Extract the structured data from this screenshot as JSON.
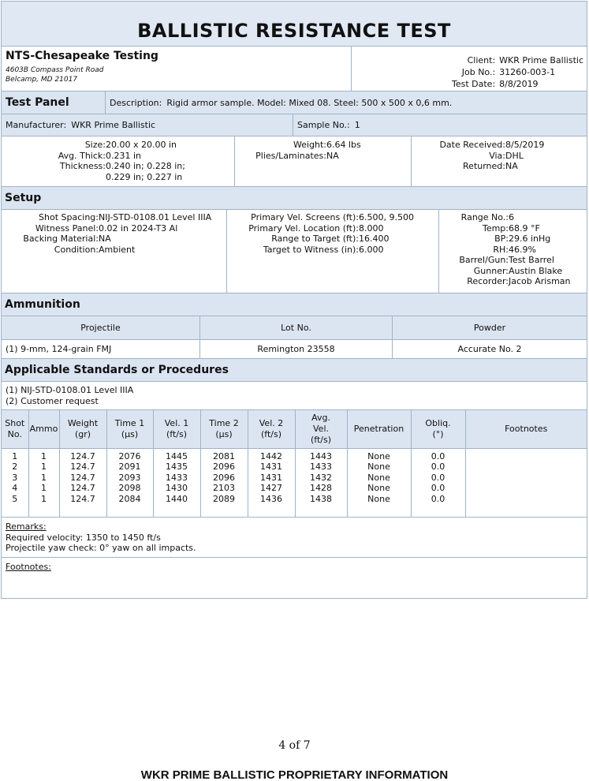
{
  "title": "BALLISTIC RESISTANCE TEST",
  "lab": {
    "name": "NTS-Chesapeake Testing",
    "address1": "4603B Compass Point Road",
    "address2": "Belcamp, MD 21017"
  },
  "client_block": {
    "client_label": "Client:",
    "client_value": "WKR Prime Ballistic",
    "job_label": "Job No.:",
    "job_value": "31260-003-1",
    "date_label": "Test Date:",
    "date_value": "8/8/2019"
  },
  "test_panel": {
    "heading": "Test Panel",
    "description_label": "Description:",
    "description_value": "Rigid armor sample. Model: Mixed 08. Steel: 500 x 500 x 0,6 mm.",
    "manufacturer_label": "Manufacturer:",
    "manufacturer_value": "WKR Prime Ballistic",
    "sample_label": "Sample No.:",
    "sample_value": "1",
    "size_label": "Size:",
    "size_value": "20.00 x 20.00 in",
    "avg_thick_label": "Avg. Thick:",
    "avg_thick_value": "0.231 in",
    "thickness_label": "Thickness:",
    "thickness_value_1": "0.240 in; 0.228 in;",
    "thickness_value_2": "0.229 in; 0.227 in",
    "weight_label": "Weight:",
    "weight_value": "6.64 lbs",
    "plies_label": "Plies/Laminates:",
    "plies_value": "NA",
    "received_label": "Date Received:",
    "received_value": "8/5/2019",
    "via_label": "Via:",
    "via_value": "DHL",
    "returned_label": "Returned:",
    "returned_value": "NA"
  },
  "setup": {
    "heading": "Setup",
    "col1": [
      {
        "label": "Shot Spacing:",
        "value": "NIJ-STD-0108.01 Level IIIA"
      },
      {
        "label": "Witness Panel:",
        "value": "0.02 in 2024-T3 Al"
      },
      {
        "label": "Backing Material:",
        "value": "NA"
      },
      {
        "label": "Condition:",
        "value": "Ambient"
      }
    ],
    "col2": [
      {
        "label": "Primary Vel. Screens (ft):",
        "value": "6.500, 9.500"
      },
      {
        "label": "Primary Vel. Location (ft):",
        "value": "8.000"
      },
      {
        "label": "Range to Target (ft):",
        "value": "16.400"
      },
      {
        "label": "Target to Witness (in):",
        "value": "6.000"
      }
    ],
    "col3": [
      {
        "label": "Range No.:",
        "value": "6"
      },
      {
        "label": "Temp:",
        "value": "68.9 °F"
      },
      {
        "label": "BP:",
        "value": "29.6 inHg"
      },
      {
        "label": "RH:",
        "value": "46.9%"
      },
      {
        "label": "Barrel/Gun:",
        "value": "Test Barrel"
      },
      {
        "label": "Gunner:",
        "value": "Austin Blake"
      },
      {
        "label": "Recorder:",
        "value": "Jacob Arisman"
      }
    ]
  },
  "ammunition": {
    "heading": "Ammunition",
    "headers": [
      "Projectile",
      "Lot No.",
      "Powder"
    ],
    "row": {
      "projectile": "(1)  9-mm, 124-grain FMJ",
      "lot": "Remington 23558",
      "powder": "Accurate No. 2"
    }
  },
  "standards": {
    "heading": "Applicable Standards or Procedures",
    "items": [
      "(1)  NIJ-STD-0108.01 Level IIIA",
      "(2)  Customer request"
    ]
  },
  "shots": {
    "headers": {
      "shot": [
        "Shot",
        "No."
      ],
      "ammo": [
        "Ammo"
      ],
      "weight": [
        "Weight",
        "(gr)"
      ],
      "time1": [
        "Time 1",
        "(µs)"
      ],
      "vel1": [
        "Vel. 1",
        "(ft/s)"
      ],
      "time2": [
        "Time 2",
        "(µs)"
      ],
      "vel2": [
        "Vel. 2",
        "(ft/s)"
      ],
      "avgvel": [
        "Avg.",
        "Vel.",
        "(ft/s)"
      ],
      "penetration": [
        "Penetration"
      ],
      "obliq": [
        "Obliq.",
        "(°)"
      ],
      "footnotes": [
        "Footnotes"
      ]
    },
    "rows": [
      {
        "shot": "1",
        "ammo": "1",
        "weight": "124.7",
        "time1": "2076",
        "vel1": "1445",
        "time2": "2081",
        "vel2": "1442",
        "avg": "1443",
        "pen": "None",
        "obliq": "0.0"
      },
      {
        "shot": "2",
        "ammo": "1",
        "weight": "124.7",
        "time1": "2091",
        "vel1": "1435",
        "time2": "2096",
        "vel2": "1431",
        "avg": "1433",
        "pen": "None",
        "obliq": "0.0"
      },
      {
        "shot": "3",
        "ammo": "1",
        "weight": "124.7",
        "time1": "2093",
        "vel1": "1433",
        "time2": "2096",
        "vel2": "1431",
        "avg": "1432",
        "pen": "None",
        "obliq": "0.0"
      },
      {
        "shot": "4",
        "ammo": "1",
        "weight": "124.7",
        "time1": "2098",
        "vel1": "1430",
        "time2": "2103",
        "vel2": "1427",
        "avg": "1428",
        "pen": "None",
        "obliq": "0.0"
      },
      {
        "shot": "5",
        "ammo": "1",
        "weight": "124.7",
        "time1": "2084",
        "vel1": "1440",
        "time2": "2089",
        "vel2": "1436",
        "avg": "1438",
        "pen": "None",
        "obliq": "0.0"
      }
    ]
  },
  "remarks": {
    "heading": "Remarks:",
    "lines": [
      "Required velocity:  1350 to 1450 ft/s",
      "Projectile yaw check:  0° yaw on all impacts."
    ]
  },
  "footnotes": {
    "heading": "Footnotes:"
  },
  "footer": {
    "page": "4 of 7",
    "proprietary": "WKR PRIME BALLISTIC PROPRIETARY INFORMATION"
  }
}
